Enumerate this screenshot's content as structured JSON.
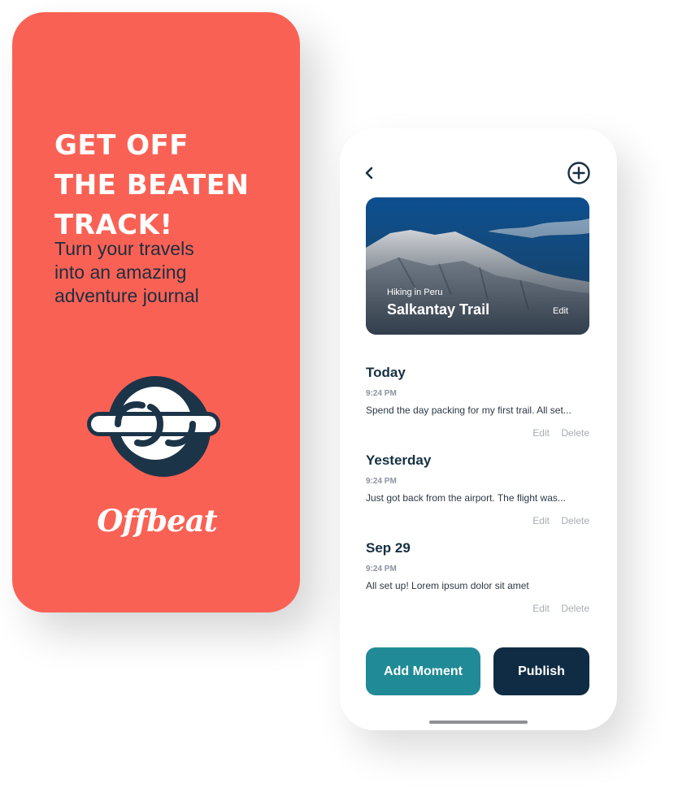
{
  "splash": {
    "headline_lines": [
      "GET OFF",
      "THE BEATEN",
      "TRACK!"
    ],
    "subtitle_lines": [
      "Turn your travels",
      "into an amazing",
      "adventure journal"
    ],
    "logo_icon": "offbeat-logo-icon",
    "wordmark": "Offbeat"
  },
  "journal": {
    "back_icon": "chevron-left-icon",
    "add_icon": "plus-circle-icon",
    "hero": {
      "kicker": "Hiking in Peru",
      "title": "Salkantay Trail",
      "edit_label": "Edit"
    },
    "entries": [
      {
        "heading": "Today",
        "time": "9:24 PM",
        "text": "Spend the day packing for my first trail. All set...",
        "edit_label": "Edit",
        "delete_label": "Delete"
      },
      {
        "heading": "Yesterday",
        "time": "9:24 PM",
        "text": "Just got back from the airport. The flight was...",
        "edit_label": "Edit",
        "delete_label": "Delete"
      },
      {
        "heading": "Sep 29",
        "time": "9:24 PM",
        "text": "All set up! Lorem ipsum dolor sit amet",
        "edit_label": "Edit",
        "delete_label": "Delete"
      }
    ],
    "add_moment_label": "Add Moment",
    "publish_label": "Publish"
  },
  "colors": {
    "splash_background": "#fa6155",
    "heading_navy": "#163042",
    "add_moment_teal": "#208b96",
    "publish_navy": "#0f2c44"
  }
}
